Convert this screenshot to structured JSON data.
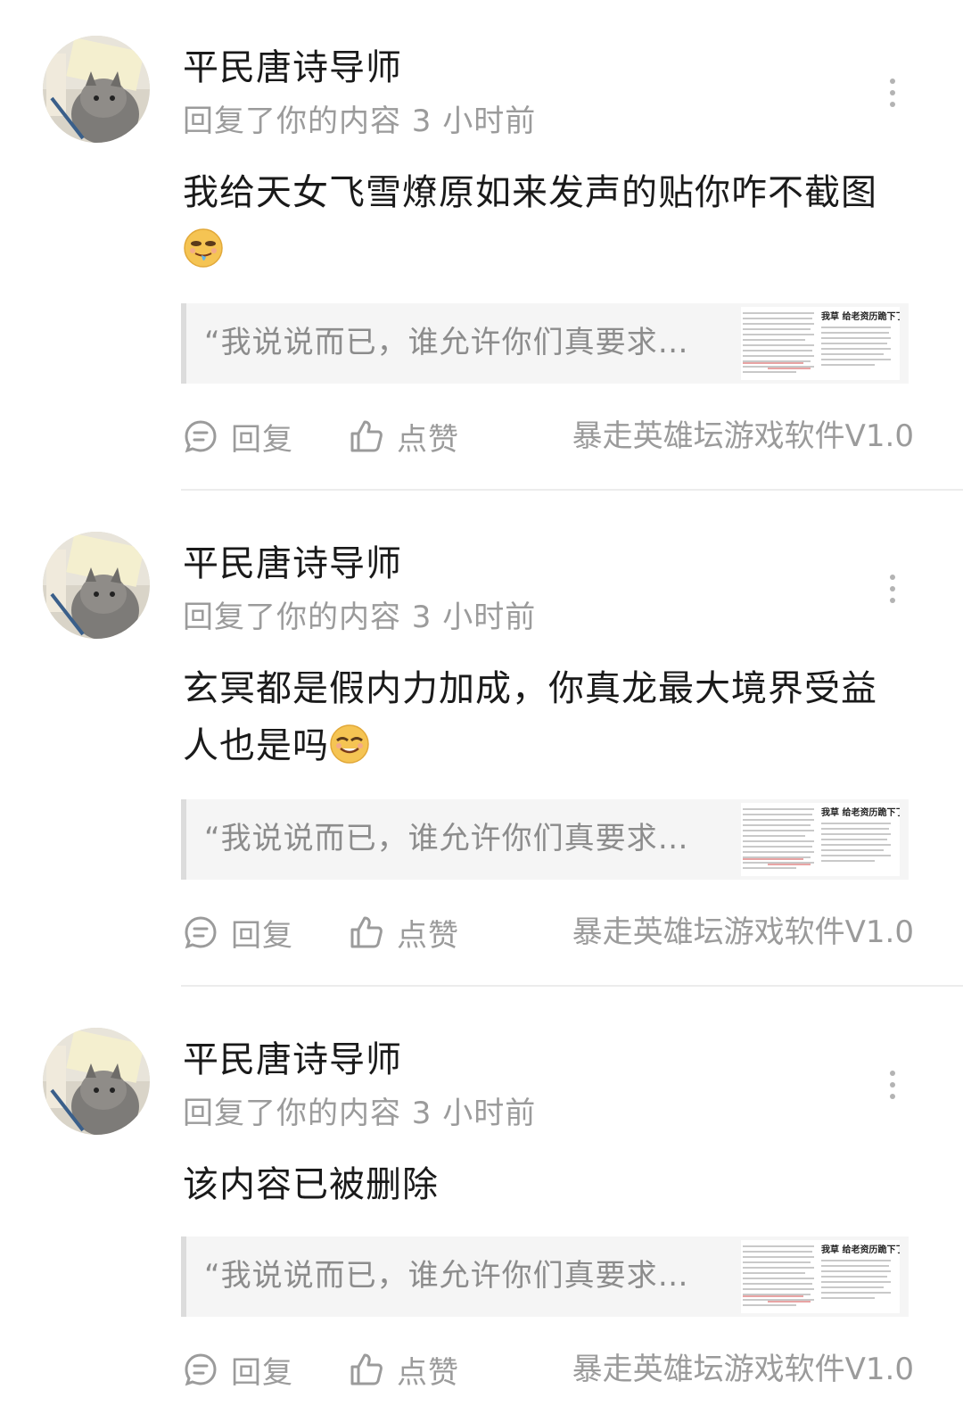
{
  "comments": [
    {
      "username": "平民唐诗导师",
      "meta": "回复了你的内容 3 小时前",
      "text": "我给天女飞雪燎原如来发声的贴你咋不截图",
      "emoji": "drooling-emoji-icon",
      "quote": "“我说说而已，谁允许你们真要求…",
      "thumbnail_title": "我草 给老资历跪下了",
      "reply_label": "回复",
      "like_label": "点赞",
      "source": "暴走英雄坛游戏软件V1.0"
    },
    {
      "username": "平民唐诗导师",
      "meta": "回复了你的内容 3 小时前",
      "text": "玄冥都是假内力加成，你真龙最大境界受益人也是吗",
      "emoji": "smug-emoji-icon",
      "quote": "“我说说而已，谁允许你们真要求…",
      "thumbnail_title": "我草 给老资历跪下了",
      "reply_label": "回复",
      "like_label": "点赞",
      "source": "暴走英雄坛游戏软件V1.0"
    },
    {
      "username": "平民唐诗导师",
      "meta": "回复了你的内容 3 小时前",
      "text": "该内容已被删除",
      "emoji": "",
      "quote": "“我说说而已，谁允许你们真要求…",
      "thumbnail_title": "我草 给老资历跪下了",
      "reply_label": "回复",
      "like_label": "点赞",
      "source": "暴走英雄坛游戏软件V1.0"
    }
  ]
}
